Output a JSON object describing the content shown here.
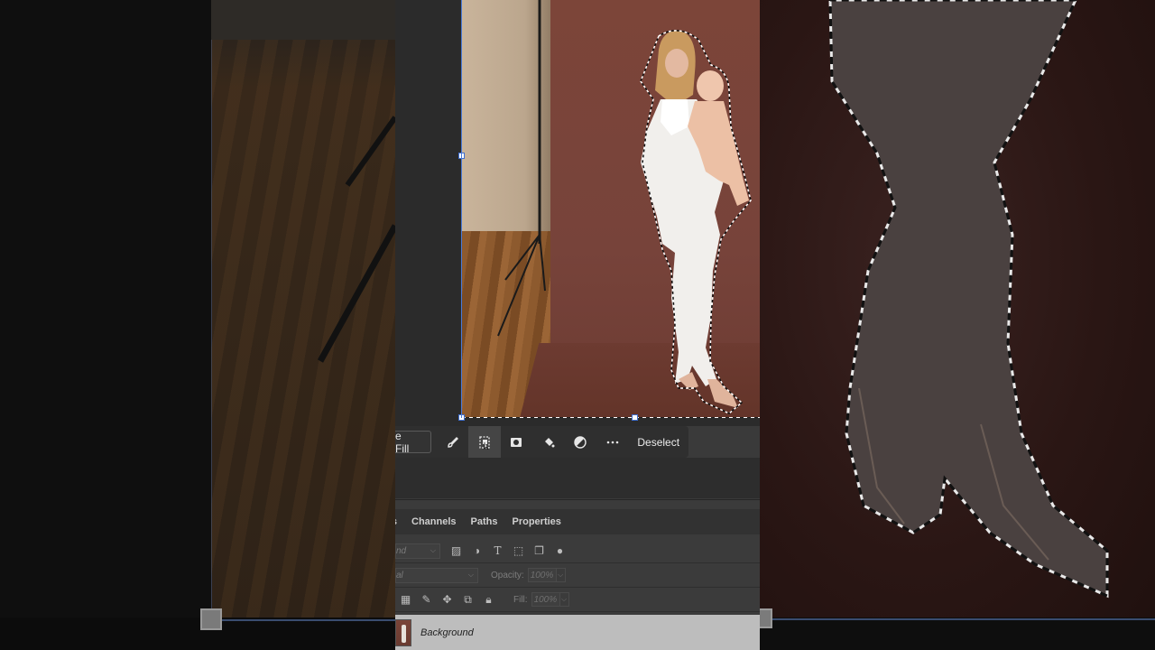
{
  "task_bar": {
    "fill_label": "e Fill",
    "deselect_label": "Deselect",
    "icons": [
      "brush-icon",
      "select-subject-icon",
      "mask-icon",
      "paint-bucket-icon",
      "adjustment-icon",
      "more-icon"
    ]
  },
  "panel": {
    "tabs": [
      {
        "label": "s"
      },
      {
        "label": "Channels"
      },
      {
        "label": "Paths"
      },
      {
        "label": "Properties"
      }
    ],
    "kind_value": "nd",
    "blend_value": "al",
    "opacity_label": "Opacity:",
    "opacity_value": "100%",
    "fill_label": "Fill:",
    "fill_value": "100%"
  },
  "layers": [
    {
      "name": "Background"
    }
  ],
  "colors": {
    "backdrop": "#7a4438",
    "selection_handle": "#3f6fd0",
    "panel_bg": "#3b3b3b"
  }
}
